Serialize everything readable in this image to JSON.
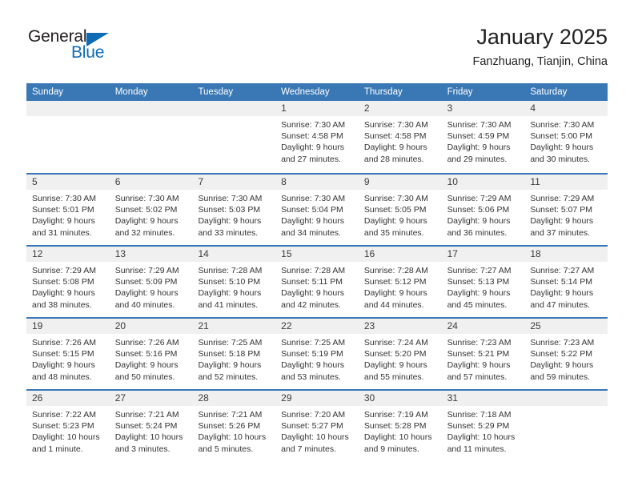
{
  "brand": {
    "name_part1": "General",
    "name_part2": "Blue",
    "accent_color": "#0e6cb5"
  },
  "header": {
    "title": "January 2025",
    "subtitle": "Fanzhuang, Tianjin, China"
  },
  "theme": {
    "header_blue": "#3a78b5",
    "day_band_gray": "#f0f0f0",
    "text_color": "#333333"
  },
  "weekday_headers": [
    "Sunday",
    "Monday",
    "Tuesday",
    "Wednesday",
    "Thursday",
    "Friday",
    "Saturday"
  ],
  "weeks": [
    [
      {
        "day": "",
        "sunrise": "",
        "sunset": "",
        "daylight_line1": "",
        "daylight_line2": ""
      },
      {
        "day": "",
        "sunrise": "",
        "sunset": "",
        "daylight_line1": "",
        "daylight_line2": ""
      },
      {
        "day": "",
        "sunrise": "",
        "sunset": "",
        "daylight_line1": "",
        "daylight_line2": ""
      },
      {
        "day": "1",
        "sunrise": "Sunrise: 7:30 AM",
        "sunset": "Sunset: 4:58 PM",
        "daylight_line1": "Daylight: 9 hours",
        "daylight_line2": "and 27 minutes."
      },
      {
        "day": "2",
        "sunrise": "Sunrise: 7:30 AM",
        "sunset": "Sunset: 4:58 PM",
        "daylight_line1": "Daylight: 9 hours",
        "daylight_line2": "and 28 minutes."
      },
      {
        "day": "3",
        "sunrise": "Sunrise: 7:30 AM",
        "sunset": "Sunset: 4:59 PM",
        "daylight_line1": "Daylight: 9 hours",
        "daylight_line2": "and 29 minutes."
      },
      {
        "day": "4",
        "sunrise": "Sunrise: 7:30 AM",
        "sunset": "Sunset: 5:00 PM",
        "daylight_line1": "Daylight: 9 hours",
        "daylight_line2": "and 30 minutes."
      }
    ],
    [
      {
        "day": "5",
        "sunrise": "Sunrise: 7:30 AM",
        "sunset": "Sunset: 5:01 PM",
        "daylight_line1": "Daylight: 9 hours",
        "daylight_line2": "and 31 minutes."
      },
      {
        "day": "6",
        "sunrise": "Sunrise: 7:30 AM",
        "sunset": "Sunset: 5:02 PM",
        "daylight_line1": "Daylight: 9 hours",
        "daylight_line2": "and 32 minutes."
      },
      {
        "day": "7",
        "sunrise": "Sunrise: 7:30 AM",
        "sunset": "Sunset: 5:03 PM",
        "daylight_line1": "Daylight: 9 hours",
        "daylight_line2": "and 33 minutes."
      },
      {
        "day": "8",
        "sunrise": "Sunrise: 7:30 AM",
        "sunset": "Sunset: 5:04 PM",
        "daylight_line1": "Daylight: 9 hours",
        "daylight_line2": "and 34 minutes."
      },
      {
        "day": "9",
        "sunrise": "Sunrise: 7:30 AM",
        "sunset": "Sunset: 5:05 PM",
        "daylight_line1": "Daylight: 9 hours",
        "daylight_line2": "and 35 minutes."
      },
      {
        "day": "10",
        "sunrise": "Sunrise: 7:29 AM",
        "sunset": "Sunset: 5:06 PM",
        "daylight_line1": "Daylight: 9 hours",
        "daylight_line2": "and 36 minutes."
      },
      {
        "day": "11",
        "sunrise": "Sunrise: 7:29 AM",
        "sunset": "Sunset: 5:07 PM",
        "daylight_line1": "Daylight: 9 hours",
        "daylight_line2": "and 37 minutes."
      }
    ],
    [
      {
        "day": "12",
        "sunrise": "Sunrise: 7:29 AM",
        "sunset": "Sunset: 5:08 PM",
        "daylight_line1": "Daylight: 9 hours",
        "daylight_line2": "and 38 minutes."
      },
      {
        "day": "13",
        "sunrise": "Sunrise: 7:29 AM",
        "sunset": "Sunset: 5:09 PM",
        "daylight_line1": "Daylight: 9 hours",
        "daylight_line2": "and 40 minutes."
      },
      {
        "day": "14",
        "sunrise": "Sunrise: 7:28 AM",
        "sunset": "Sunset: 5:10 PM",
        "daylight_line1": "Daylight: 9 hours",
        "daylight_line2": "and 41 minutes."
      },
      {
        "day": "15",
        "sunrise": "Sunrise: 7:28 AM",
        "sunset": "Sunset: 5:11 PM",
        "daylight_line1": "Daylight: 9 hours",
        "daylight_line2": "and 42 minutes."
      },
      {
        "day": "16",
        "sunrise": "Sunrise: 7:28 AM",
        "sunset": "Sunset: 5:12 PM",
        "daylight_line1": "Daylight: 9 hours",
        "daylight_line2": "and 44 minutes."
      },
      {
        "day": "17",
        "sunrise": "Sunrise: 7:27 AM",
        "sunset": "Sunset: 5:13 PM",
        "daylight_line1": "Daylight: 9 hours",
        "daylight_line2": "and 45 minutes."
      },
      {
        "day": "18",
        "sunrise": "Sunrise: 7:27 AM",
        "sunset": "Sunset: 5:14 PM",
        "daylight_line1": "Daylight: 9 hours",
        "daylight_line2": "and 47 minutes."
      }
    ],
    [
      {
        "day": "19",
        "sunrise": "Sunrise: 7:26 AM",
        "sunset": "Sunset: 5:15 PM",
        "daylight_line1": "Daylight: 9 hours",
        "daylight_line2": "and 48 minutes."
      },
      {
        "day": "20",
        "sunrise": "Sunrise: 7:26 AM",
        "sunset": "Sunset: 5:16 PM",
        "daylight_line1": "Daylight: 9 hours",
        "daylight_line2": "and 50 minutes."
      },
      {
        "day": "21",
        "sunrise": "Sunrise: 7:25 AM",
        "sunset": "Sunset: 5:18 PM",
        "daylight_line1": "Daylight: 9 hours",
        "daylight_line2": "and 52 minutes."
      },
      {
        "day": "22",
        "sunrise": "Sunrise: 7:25 AM",
        "sunset": "Sunset: 5:19 PM",
        "daylight_line1": "Daylight: 9 hours",
        "daylight_line2": "and 53 minutes."
      },
      {
        "day": "23",
        "sunrise": "Sunrise: 7:24 AM",
        "sunset": "Sunset: 5:20 PM",
        "daylight_line1": "Daylight: 9 hours",
        "daylight_line2": "and 55 minutes."
      },
      {
        "day": "24",
        "sunrise": "Sunrise: 7:23 AM",
        "sunset": "Sunset: 5:21 PM",
        "daylight_line1": "Daylight: 9 hours",
        "daylight_line2": "and 57 minutes."
      },
      {
        "day": "25",
        "sunrise": "Sunrise: 7:23 AM",
        "sunset": "Sunset: 5:22 PM",
        "daylight_line1": "Daylight: 9 hours",
        "daylight_line2": "and 59 minutes."
      }
    ],
    [
      {
        "day": "26",
        "sunrise": "Sunrise: 7:22 AM",
        "sunset": "Sunset: 5:23 PM",
        "daylight_line1": "Daylight: 10 hours",
        "daylight_line2": "and 1 minute."
      },
      {
        "day": "27",
        "sunrise": "Sunrise: 7:21 AM",
        "sunset": "Sunset: 5:24 PM",
        "daylight_line1": "Daylight: 10 hours",
        "daylight_line2": "and 3 minutes."
      },
      {
        "day": "28",
        "sunrise": "Sunrise: 7:21 AM",
        "sunset": "Sunset: 5:26 PM",
        "daylight_line1": "Daylight: 10 hours",
        "daylight_line2": "and 5 minutes."
      },
      {
        "day": "29",
        "sunrise": "Sunrise: 7:20 AM",
        "sunset": "Sunset: 5:27 PM",
        "daylight_line1": "Daylight: 10 hours",
        "daylight_line2": "and 7 minutes."
      },
      {
        "day": "30",
        "sunrise": "Sunrise: 7:19 AM",
        "sunset": "Sunset: 5:28 PM",
        "daylight_line1": "Daylight: 10 hours",
        "daylight_line2": "and 9 minutes."
      },
      {
        "day": "31",
        "sunrise": "Sunrise: 7:18 AM",
        "sunset": "Sunset: 5:29 PM",
        "daylight_line1": "Daylight: 10 hours",
        "daylight_line2": "and 11 minutes."
      },
      {
        "day": "",
        "sunrise": "",
        "sunset": "",
        "daylight_line1": "",
        "daylight_line2": ""
      }
    ]
  ]
}
